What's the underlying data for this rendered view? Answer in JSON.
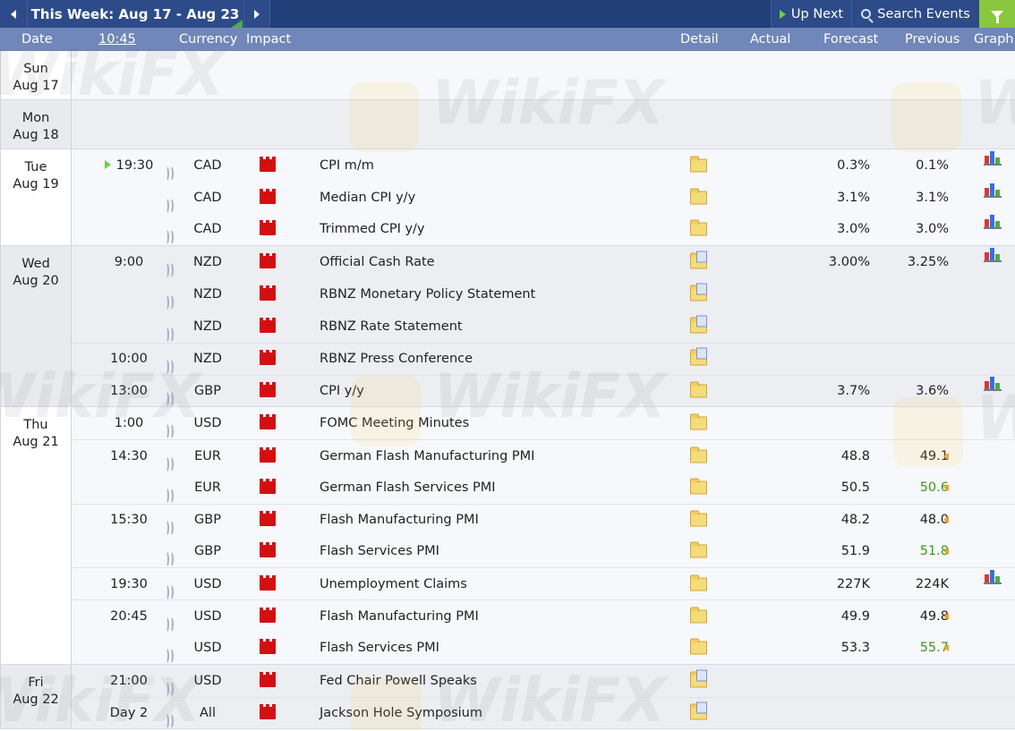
{
  "toolbar": {
    "week_label": "This Week: Aug 17 - Aug 23",
    "up_next_label": "Up Next",
    "search_label": "Search Events"
  },
  "columns": {
    "date": "Date",
    "time": "10:45",
    "currency": "Currency",
    "impact": "Impact",
    "detail": "Detail",
    "actual": "Actual",
    "forecast": "Forecast",
    "previous": "Previous",
    "graph": "Graph"
  },
  "watermark": "WikiFX",
  "days": [
    {
      "weekday": "Sun",
      "date": "Aug 17",
      "events": []
    },
    {
      "weekday": "Mon",
      "date": "Aug 18",
      "events": []
    },
    {
      "weekday": "Tue",
      "date": "Aug 19",
      "events": [
        {
          "time": "19:30",
          "currency": "CAD",
          "name": "CPI m/m",
          "forecast": "0.3%",
          "previous": "0.1%"
        },
        {
          "time": "",
          "currency": "CAD",
          "name": "Median CPI y/y",
          "forecast": "3.1%",
          "previous": "3.1%"
        },
        {
          "time": "",
          "currency": "CAD",
          "name": "Trimmed CPI y/y",
          "forecast": "3.0%",
          "previous": "3.0%"
        }
      ]
    },
    {
      "weekday": "Wed",
      "date": "Aug 20",
      "events": [
        {
          "time": "9:00",
          "currency": "NZD",
          "name": "Official Cash Rate",
          "forecast": "3.00%",
          "previous": "3.25%"
        },
        {
          "time": "",
          "currency": "NZD",
          "name": "RBNZ Monetary Policy Statement",
          "forecast": "",
          "previous": ""
        },
        {
          "time": "",
          "currency": "NZD",
          "name": "RBNZ Rate Statement",
          "forecast": "",
          "previous": ""
        },
        {
          "time": "10:00",
          "currency": "NZD",
          "name": "RBNZ Press Conference",
          "forecast": "",
          "previous": ""
        },
        {
          "time": "13:00",
          "currency": "GBP",
          "name": "CPI y/y",
          "forecast": "3.7%",
          "previous": "3.6%"
        }
      ]
    },
    {
      "weekday": "Thu",
      "date": "Aug 21",
      "events": [
        {
          "time": "1:00",
          "currency": "USD",
          "name": "FOMC Meeting Minutes",
          "forecast": "",
          "previous": ""
        },
        {
          "time": "14:30",
          "currency": "EUR",
          "name": "German Flash Manufacturing PMI",
          "forecast": "48.8",
          "previous": "49.1"
        },
        {
          "time": "",
          "currency": "EUR",
          "name": "German Flash Services PMI",
          "forecast": "50.5",
          "previous": "50.6"
        },
        {
          "time": "15:30",
          "currency": "GBP",
          "name": "Flash Manufacturing PMI",
          "forecast": "48.2",
          "previous": "48.0"
        },
        {
          "time": "",
          "currency": "GBP",
          "name": "Flash Services PMI",
          "forecast": "51.9",
          "previous": "51.8"
        },
        {
          "time": "19:30",
          "currency": "USD",
          "name": "Unemployment Claims",
          "forecast": "227K",
          "previous": "224K"
        },
        {
          "time": "20:45",
          "currency": "USD",
          "name": "Flash Manufacturing PMI",
          "forecast": "49.9",
          "previous": "49.8"
        },
        {
          "time": "",
          "currency": "USD",
          "name": "Flash Services PMI",
          "forecast": "53.3",
          "previous": "55.7"
        }
      ]
    },
    {
      "weekday": "Fri",
      "date": "Aug 22",
      "events": [
        {
          "time": "21:00",
          "currency": "USD",
          "name": "Fed Chair Powell Speaks",
          "forecast": "",
          "previous": ""
        },
        {
          "time": "Day 2",
          "currency": "All",
          "name": "Jackson Hole Symposium",
          "forecast": "",
          "previous": ""
        }
      ]
    }
  ]
}
